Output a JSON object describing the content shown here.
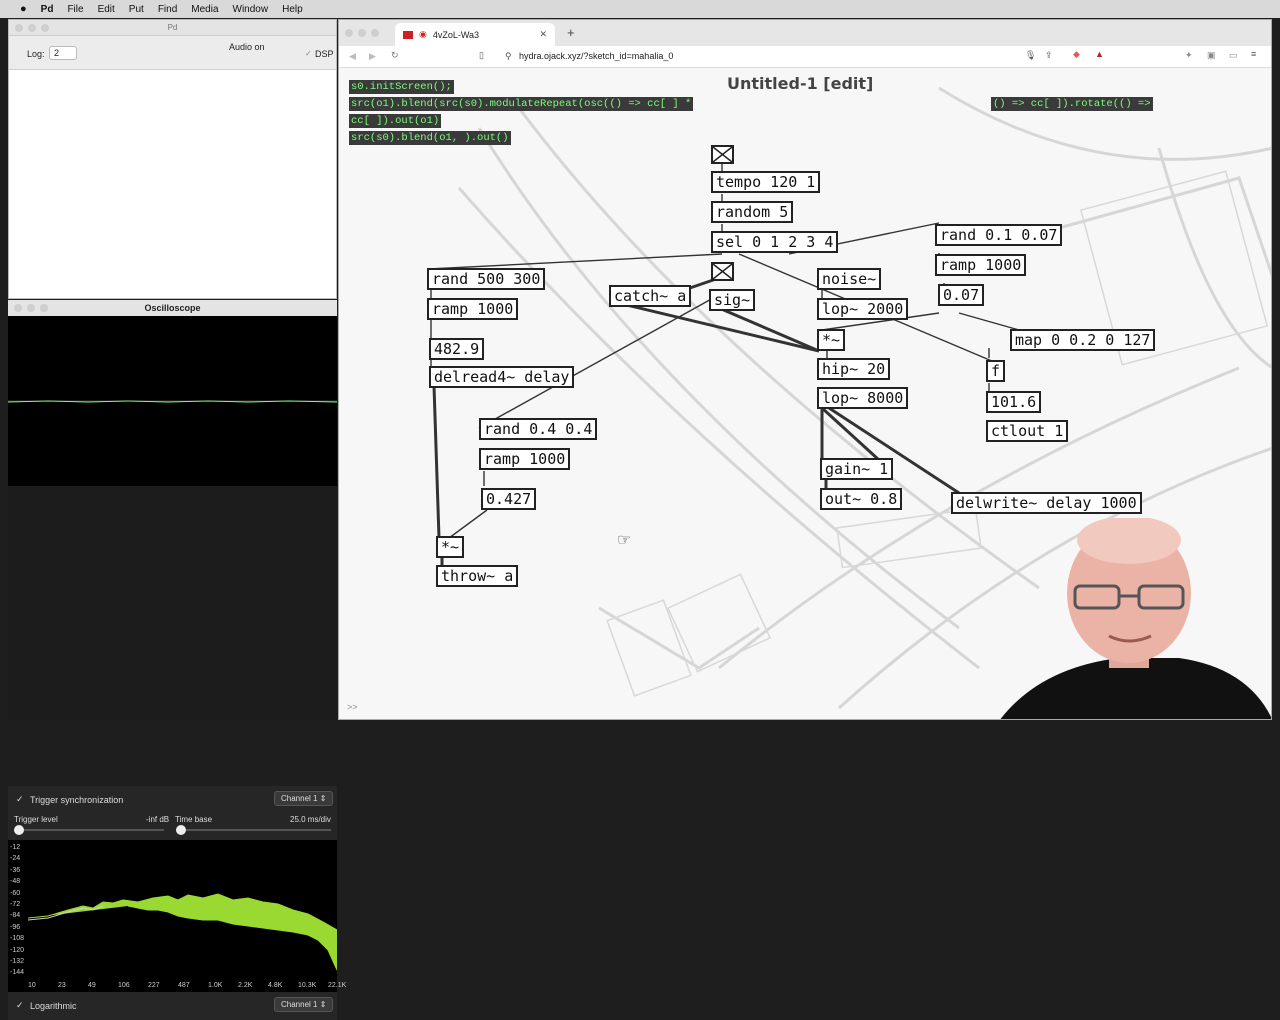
{
  "menubar": {
    "items": [
      "Pd",
      "File",
      "Edit",
      "Put",
      "Find",
      "Media",
      "Window",
      "Help"
    ]
  },
  "pd_window": {
    "title": "Pd",
    "log_label": "Log:",
    "log_value": "2",
    "audio_status": "Audio on",
    "dsp_label": "DSP"
  },
  "oscilloscope": {
    "title": "Oscilloscope",
    "trigger_sync_label": "Trigger synchronization",
    "channel_top": "Channel 1",
    "trigger_level_label": "Trigger level",
    "trigger_level_value": "-inf dB",
    "time_base_label": "Time base",
    "time_base_value": "25.0 ms/div",
    "db_ticks": [
      "-12",
      "-24",
      "-36",
      "-48",
      "-60",
      "-72",
      "-84",
      "-96",
      "-108",
      "-120",
      "-132",
      "-144"
    ],
    "freq_ticks": [
      "10",
      "23",
      "49",
      "106",
      "227",
      "487",
      "1.0K",
      "2.2K",
      "4.8K",
      "10.3K",
      "22.1K"
    ],
    "logarithmic_label": "Logarithmic",
    "channel_bottom": "Channel 1"
  },
  "browser": {
    "tab_title": "4vZoL-Wa3",
    "url": "hydra.ojack.xyz/?sketch_id=mahalia_0",
    "console_prompt": ">>"
  },
  "hydra_code": [
    "s0.initScreen();",
    "src(o1).blend(src(s0).modulateRepeat(osc(() => cc[ ] * ",
    "cc[ ]).out(o1)",
    "src(s0).blend(o1,    ).out()"
  ],
  "hydra_code_tail": "() => cc[ ]).rotate(() =>",
  "pd_patch": {
    "title": "Untitled-1 [edit]",
    "objects": {
      "tempo": "tempo 120 1",
      "random": "random 5",
      "sel": "sel 0 1 2 3 4",
      "rand1": "rand 500 300",
      "ramp1": "ramp 1000",
      "num1": "482.9",
      "delread": "delread4~ delay",
      "catch": "catch~ a",
      "sig": "sig~",
      "noise": "noise~",
      "lop1": "lop~ 2000",
      "mul1": "*~",
      "hip": "hip~ 20",
      "lop2": "lop~ 8000",
      "gain": "gain~ 1",
      "out": "out~ 0.8",
      "rand2": "rand 0.1 0.07",
      "ramp2": "ramp 1000",
      "num2": "0.07",
      "map": "map 0 0.2 0 127",
      "f": "f",
      "num3": "101.6",
      "ctlout": "ctlout 1",
      "delwrite": "delwrite~ delay 1000",
      "rand3": "rand 0.4 0.4",
      "ramp3": "ramp 1000",
      "num4": "0.427",
      "mul2": "*~",
      "throw": "throw~ a"
    }
  },
  "colors": {
    "hydra_text": "#7aff7a",
    "scope_trace": "#7aff7a",
    "spectrum": "#b6ff3a"
  }
}
